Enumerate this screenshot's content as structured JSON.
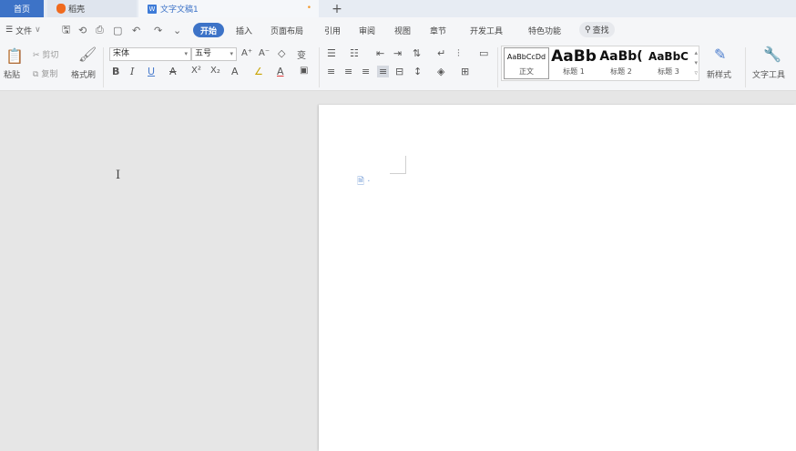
{
  "tabs": {
    "home": "首页",
    "docer": "稻壳",
    "document": "文字文稿1",
    "modified_dot": "•",
    "new_tab": "+"
  },
  "menu": {
    "file": "文件",
    "file_icon": "☰",
    "file_dropdown": "∨",
    "items": [
      "开始",
      "插入",
      "页面布局",
      "引用",
      "审阅",
      "视图",
      "章节",
      "开发工具",
      "特色功能"
    ],
    "search": "查找",
    "quick_access": {
      "save": "🖫",
      "undo": "↶",
      "redo": "↷",
      "print": "⎙",
      "preview": "🔍",
      "more": "⌄"
    }
  },
  "ribbon": {
    "clipboard": {
      "paste": "粘贴",
      "cut": "剪切",
      "copy": "复制",
      "format_painter": "格式刷"
    },
    "font": {
      "name": "宋体",
      "size": "五号",
      "dropdown": "▾",
      "grow": "A⁺",
      "shrink": "A⁻",
      "clear": "◇",
      "phonetic": "变",
      "bold": "B",
      "italic": "I",
      "underline": "U",
      "strike": "A",
      "superscript": "X²",
      "subscript": "X₂",
      "effects": "A",
      "highlight": "∠",
      "color": "A",
      "border": "▣"
    },
    "paragraph": {
      "bullets": "☰",
      "numbering": "☷",
      "outdent": "⇤",
      "indent": "⇥",
      "sort": "⇅",
      "show_marks": "↵",
      "align_left": "≡",
      "align_center": "≡",
      "align_right": "≡",
      "justify": "≡",
      "distribute": "⊟",
      "line_spacing": "↕",
      "shading": "◈",
      "borders": "⊞"
    },
    "styles": [
      {
        "sample": "AaBbCcDd",
        "label": "正文"
      },
      {
        "sample": "AaBb",
        "label": "标题 1"
      },
      {
        "sample": "AaBb(",
        "label": "标题 2"
      },
      {
        "sample": "AaBbC",
        "label": "标题 3"
      }
    ],
    "new_style": "新样式",
    "text_tools": "文字工具"
  },
  "document": {
    "cursor": "I",
    "para_mark": "🗎 ·"
  }
}
